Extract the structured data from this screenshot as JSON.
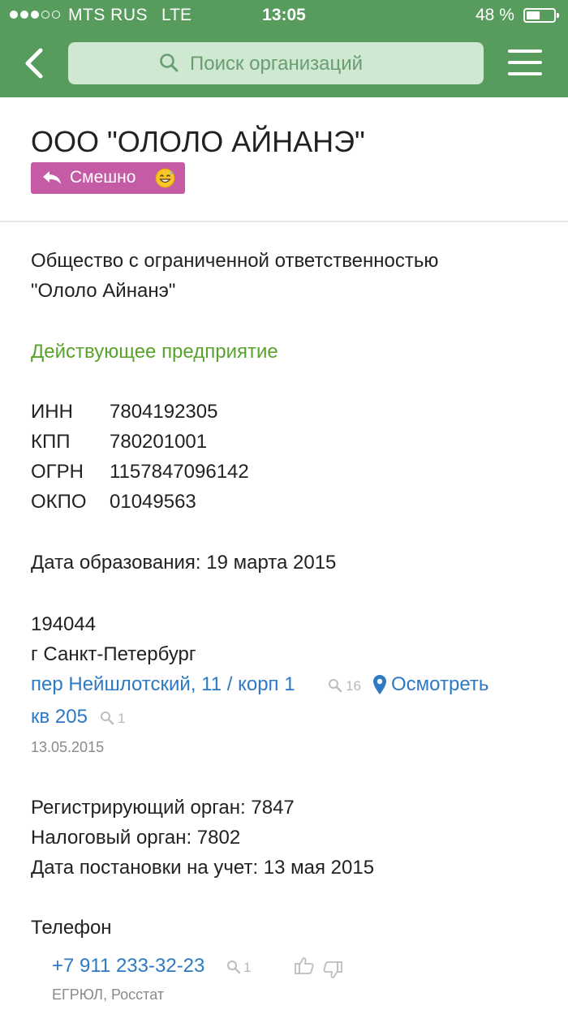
{
  "status_bar": {
    "signal": {
      "filled": 3,
      "total": 5
    },
    "carrier": "MTS RUS",
    "network": "LTE",
    "time": "13:05",
    "battery_text": "48 %",
    "battery_level": 0.48
  },
  "nav": {
    "back_icon": "chevron-left-icon",
    "search_icon": "search-icon",
    "search_placeholder": "Поиск организаций",
    "menu_icon": "hamburger-menu-icon",
    "bar_color": "#579c5d"
  },
  "org": {
    "title": "ООО \"ОЛОЛО АЙНАНЭ\"",
    "tag_label": "Смешно",
    "tag_color": "#c45ba4",
    "tag_icon": "reply-arrow-icon",
    "tag_emoji": "sweat-smile-emoji",
    "full_name_line1": "Общество с ограниченной ответственностью",
    "full_name_line2": "\"Ололо Айнанэ\"",
    "status": "Действующее предприятие",
    "codes": [
      {
        "label": "ИНН",
        "value": "7804192305"
      },
      {
        "label": "КПП",
        "value": "780201001"
      },
      {
        "label": "ОГРН",
        "value": "1157847096142"
      },
      {
        "label": "ОКПО",
        "value": "01049563"
      }
    ],
    "founded": "Дата образования: 19 марта 2015"
  },
  "address": {
    "postcode": "194044",
    "city": "г Санкт-Петербург",
    "street": "пер Нейшлотский, 11 / корп 1",
    "street_count": "16",
    "view_map": "Осмотреть",
    "map_icon": "map-pin-icon",
    "apartment": "кв 205",
    "apartment_count": "1",
    "date": "13.05.2015"
  },
  "registration": {
    "reg_authority": "Регистрирующий орган: 7847",
    "tax_authority": "Налоговый орган: 7802",
    "registered_date": "Дата постановки на учет: 13 мая 2015"
  },
  "phone": {
    "heading": "Телефон",
    "number": "+7 911 233-32-23",
    "count": "1",
    "like_icon": "thumbs-up-icon",
    "dislike_icon": "thumbs-down-icon",
    "source": "ЕГРЮЛ, Росстат"
  }
}
